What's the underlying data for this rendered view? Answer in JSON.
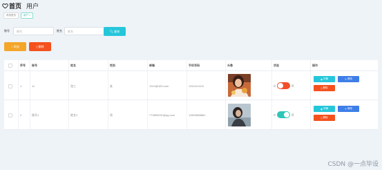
{
  "header": {
    "home_label": "首页",
    "title": "用户"
  },
  "tags": [
    {
      "label": "系统首页"
    },
    {
      "label": "用户 ×"
    }
  ],
  "search": {
    "account_label": "账号",
    "account_placeholder": "账号",
    "name_label": "姓名",
    "name_placeholder": "姓名",
    "search_button": "查询"
  },
  "actions": {
    "add": "添加",
    "delete": "删除"
  },
  "table": {
    "headers": [
      "序号",
      "账号",
      "姓名",
      "性别",
      "邮箱",
      "手机号码",
      "头像",
      "状态",
      "操作"
    ],
    "rows": [
      {
        "index": "1",
        "account": "11",
        "name": "张三",
        "gender": "女",
        "email": "1314@163.com",
        "phone": "13111111111",
        "status": "off",
        "status_label": "止"
      },
      {
        "index": "2",
        "account": "账号1",
        "name": "姓名1",
        "gender": "男",
        "email": "773890001@qq.com",
        "phone": "13823888881",
        "status": "on",
        "status_label": "止"
      }
    ],
    "status_prefix": "ᐸ",
    "ops": {
      "view": "详情",
      "edit": "修改",
      "delete": "删除"
    }
  },
  "watermark": "CSDN @一点毕设",
  "colors": {
    "search": "#26c6da",
    "add": "#f4a62a",
    "delete": "#f4511e",
    "edit": "#3e7ee8",
    "switch_on": "#2ec5b6",
    "switch_off": "#f24f2a"
  }
}
